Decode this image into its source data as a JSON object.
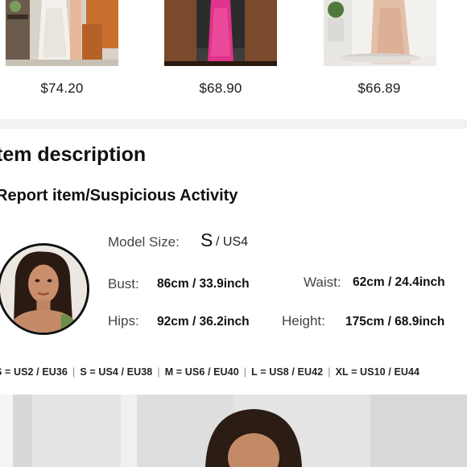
{
  "products": [
    {
      "price": "$74.20"
    },
    {
      "price": "$68.90"
    },
    {
      "price": "$66.89"
    }
  ],
  "description": {
    "title": "tem description",
    "report_link": "Report item/Suspicious Activity"
  },
  "model": {
    "size_label": "Model Size:",
    "size_value": "S",
    "size_us": "/ US4",
    "bust_label": "Bust:",
    "bust_value": "86cm / 33.9inch",
    "waist_label": "Waist:",
    "waist_value": "62cm / 24.4inch",
    "hips_label": "Hips:",
    "hips_value": "92cm / 36.2inch",
    "height_label": "Height:",
    "height_value": "175cm / 68.9inch"
  },
  "size_chart": [
    "S = US2 / EU36",
    "S = US4 / EU38",
    "M = US6 / EU40",
    "L = US8 / EU42",
    "XL = US10 / EU44"
  ],
  "icons": {
    "product_image_1": "dress-photo-white-lace",
    "product_image_2": "dress-photo-pink-sequin",
    "product_image_3": "dress-photo-champagne",
    "avatar": "model-portrait"
  },
  "colors": {
    "divider": "#f2f2f2",
    "text": "#111111"
  }
}
